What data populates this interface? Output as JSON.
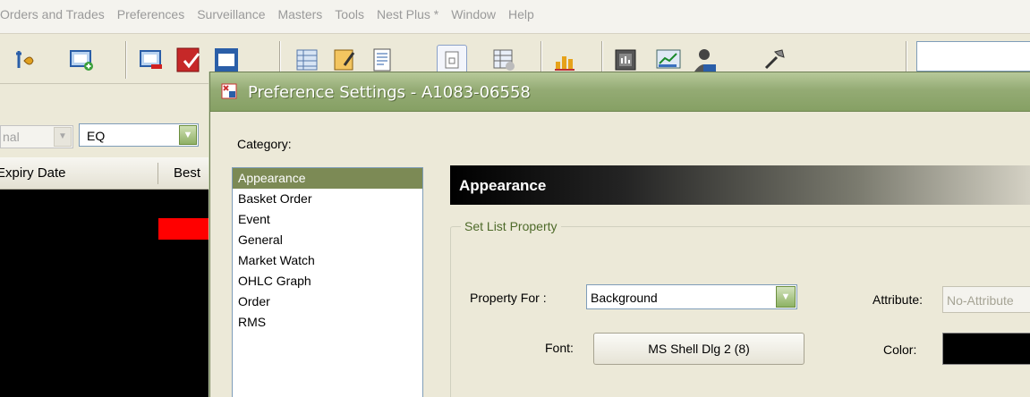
{
  "menubar": {
    "items": [
      "Orders and Trades",
      "Preferences",
      "Surveillance",
      "Masters",
      "Tools",
      "Nest Plus *",
      "Window",
      "Help"
    ]
  },
  "toolbar": {
    "icons": [
      "filter-icon",
      "add-watch-icon",
      "remove-watch-icon",
      "order-icon",
      "window-icon",
      "grid-icon",
      "notepad-icon",
      "report-icon",
      "blank-doc-icon",
      "table-icon",
      "chart-icon",
      "terminal-icon",
      "screen-chart-icon",
      "user-icon",
      "tools-icon"
    ]
  },
  "subbar": {
    "instrument_value": "nal",
    "series_value": "EQ"
  },
  "grid": {
    "col_expiry": "Expiry Date",
    "col_best": "Best"
  },
  "dialog": {
    "title": "Preference Settings - A1083-06558",
    "category_label": "Category:",
    "categories": [
      "Appearance",
      "Basket Order",
      "Event",
      "General",
      "Market Watch",
      "OHLC Graph",
      "Order",
      "RMS"
    ],
    "selected_category": "Appearance",
    "panel_title": "Appearance",
    "group_title": "Set List Property",
    "property_for_label": "Property  For :",
    "property_for_value": "Background",
    "attribute_label": "Attribute:",
    "attribute_value": "No-Attribute",
    "font_label": "Font:",
    "font_value": "MS Shell Dlg 2 (8)",
    "color_label": "Color:",
    "color_value": "#000000"
  },
  "colors": {
    "selection": "#7c8a55",
    "titlebar": "#94ab74",
    "group_title": "#4e6a2a"
  }
}
